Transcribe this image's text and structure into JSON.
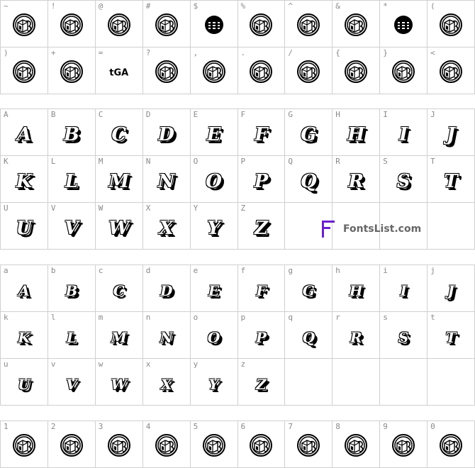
{
  "sections": [
    {
      "id": "symbols",
      "kind": "emblem",
      "cells": [
        {
          "label": "~",
          "glyph": "emblem"
        },
        {
          "label": "!",
          "glyph": "emblem"
        },
        {
          "label": "@",
          "glyph": "emblem"
        },
        {
          "label": "#",
          "glyph": "emblem"
        },
        {
          "label": "$",
          "glyph": "dark-emblem"
        },
        {
          "label": "%",
          "glyph": "emblem"
        },
        {
          "label": "^",
          "glyph": "emblem"
        },
        {
          "label": "&",
          "glyph": "emblem"
        },
        {
          "label": "*",
          "glyph": "dark-emblem"
        },
        {
          "label": "(",
          "glyph": "emblem"
        },
        {
          "label": ")",
          "glyph": "emblem"
        },
        {
          "label": "+",
          "glyph": "emblem"
        },
        {
          "label": "=",
          "glyph": "text",
          "text": "tGA"
        },
        {
          "label": "?",
          "glyph": "emblem"
        },
        {
          "label": ",",
          "glyph": "emblem"
        },
        {
          "label": ".",
          "glyph": "emblem"
        },
        {
          "label": "/",
          "glyph": "emblem"
        },
        {
          "label": "{",
          "glyph": "emblem"
        },
        {
          "label": "}",
          "glyph": "emblem"
        },
        {
          "label": "<",
          "glyph": "emblem"
        }
      ]
    },
    {
      "id": "uppercase",
      "kind": "letters",
      "cells": [
        {
          "label": "A",
          "glyph": "A"
        },
        {
          "label": "B",
          "glyph": "B"
        },
        {
          "label": "C",
          "glyph": "C"
        },
        {
          "label": "D",
          "glyph": "D"
        },
        {
          "label": "E",
          "glyph": "E"
        },
        {
          "label": "F",
          "glyph": "F"
        },
        {
          "label": "G",
          "glyph": "G"
        },
        {
          "label": "H",
          "glyph": "H"
        },
        {
          "label": "I",
          "glyph": "I"
        },
        {
          "label": "J",
          "glyph": "J"
        },
        {
          "label": "K",
          "glyph": "K"
        },
        {
          "label": "L",
          "glyph": "L"
        },
        {
          "label": "M",
          "glyph": "M"
        },
        {
          "label": "N",
          "glyph": "N"
        },
        {
          "label": "O",
          "glyph": "O"
        },
        {
          "label": "P",
          "glyph": "P"
        },
        {
          "label": "Q",
          "glyph": "Q"
        },
        {
          "label": "R",
          "glyph": "R"
        },
        {
          "label": "S",
          "glyph": "S"
        },
        {
          "label": "T",
          "glyph": "T"
        },
        {
          "label": "U",
          "glyph": "U"
        },
        {
          "label": "V",
          "glyph": "V"
        },
        {
          "label": "W",
          "glyph": "W"
        },
        {
          "label": "X",
          "glyph": "X"
        },
        {
          "label": "Y",
          "glyph": "Y"
        },
        {
          "label": "Z",
          "glyph": "Z"
        },
        {
          "label": "",
          "glyph": ""
        },
        {
          "label": "",
          "glyph": ""
        },
        {
          "label": "",
          "glyph": ""
        },
        {
          "label": "",
          "glyph": ""
        }
      ]
    },
    {
      "id": "lowercase",
      "kind": "letters-small",
      "cells": [
        {
          "label": "a",
          "glyph": "A"
        },
        {
          "label": "b",
          "glyph": "B"
        },
        {
          "label": "c",
          "glyph": "C"
        },
        {
          "label": "d",
          "glyph": "D"
        },
        {
          "label": "e",
          "glyph": "E"
        },
        {
          "label": "f",
          "glyph": "F"
        },
        {
          "label": "g",
          "glyph": "G"
        },
        {
          "label": "h",
          "glyph": "H"
        },
        {
          "label": "i",
          "glyph": "I"
        },
        {
          "label": "j",
          "glyph": "J"
        },
        {
          "label": "k",
          "glyph": "K"
        },
        {
          "label": "l",
          "glyph": "L"
        },
        {
          "label": "m",
          "glyph": "M"
        },
        {
          "label": "n",
          "glyph": "N"
        },
        {
          "label": "o",
          "glyph": "O"
        },
        {
          "label": "p",
          "glyph": "P"
        },
        {
          "label": "q",
          "glyph": "Q"
        },
        {
          "label": "r",
          "glyph": "R"
        },
        {
          "label": "s",
          "glyph": "S"
        },
        {
          "label": "t",
          "glyph": "T"
        },
        {
          "label": "u",
          "glyph": "U"
        },
        {
          "label": "v",
          "glyph": "V"
        },
        {
          "label": "w",
          "glyph": "W"
        },
        {
          "label": "x",
          "glyph": "X"
        },
        {
          "label": "y",
          "glyph": "Y"
        },
        {
          "label": "z",
          "glyph": "Z"
        },
        {
          "label": "",
          "glyph": ""
        },
        {
          "label": "",
          "glyph": ""
        },
        {
          "label": "",
          "glyph": ""
        },
        {
          "label": "",
          "glyph": ""
        }
      ]
    },
    {
      "id": "digits",
      "kind": "emblem",
      "cells": [
        {
          "label": "1",
          "glyph": "emblem"
        },
        {
          "label": "2",
          "glyph": "emblem"
        },
        {
          "label": "3",
          "glyph": "emblem"
        },
        {
          "label": "4",
          "glyph": "emblem"
        },
        {
          "label": "5",
          "glyph": "emblem"
        },
        {
          "label": "6",
          "glyph": "emblem"
        },
        {
          "label": "7",
          "glyph": "emblem"
        },
        {
          "label": "8",
          "glyph": "emblem"
        },
        {
          "label": "9",
          "glyph": "emblem"
        },
        {
          "label": "0",
          "glyph": "emblem"
        }
      ]
    }
  ],
  "watermark": {
    "text": "FontsList.com",
    "accent": "#6a1fd0"
  }
}
